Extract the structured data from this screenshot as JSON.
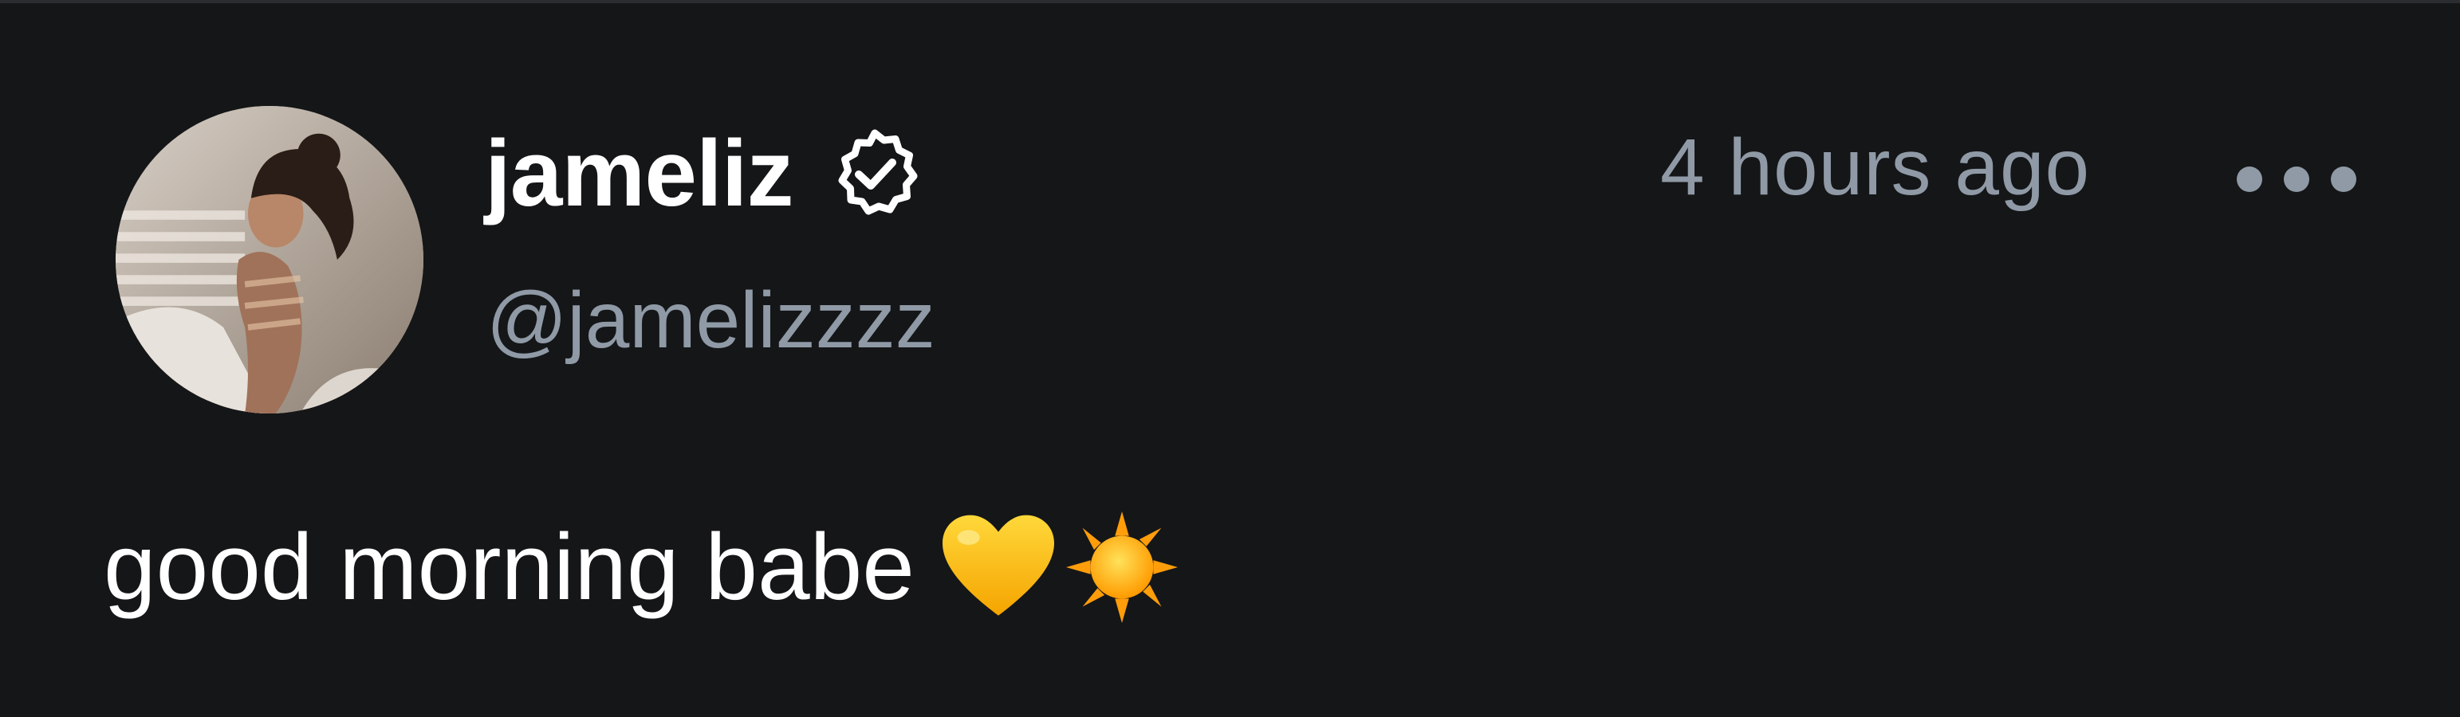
{
  "post": {
    "author": {
      "display_name": "jameliz",
      "handle": "@jamelizzzz",
      "verified": true,
      "avatar_alt": "profile photo"
    },
    "timestamp": "4 hours ago",
    "text": "good morning babe",
    "emojis": [
      "yellow-heart-icon",
      "sun-icon"
    ],
    "more_menu_icon": "more-horizontal-icon"
  },
  "colors": {
    "background": "#151618",
    "primary_text": "#ffffff",
    "secondary_text": "#8f9aa6"
  }
}
